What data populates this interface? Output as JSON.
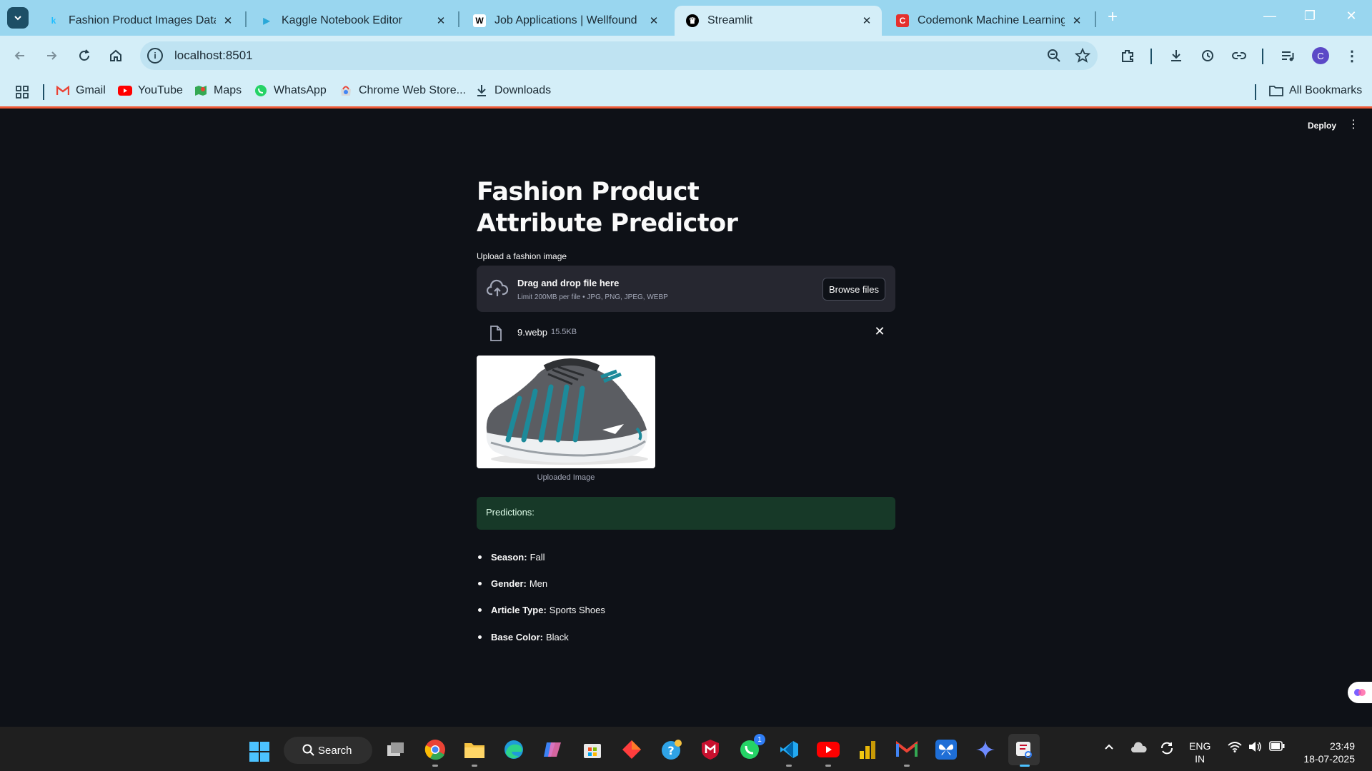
{
  "browser": {
    "tabs": [
      {
        "title": "Fashion Product Images Datase",
        "favicon": "kaggle-icon"
      },
      {
        "title": "Kaggle Notebook Editor",
        "favicon": "play-icon"
      },
      {
        "title": "Job Applications | Wellfound",
        "favicon": "wellfound-icon"
      },
      {
        "title": "Streamlit",
        "favicon": "streamlit-icon",
        "active": true
      },
      {
        "title": "Codemonk Machine Learning Ir",
        "favicon": "codemonk-icon"
      }
    ],
    "url": "localhost:8501",
    "profile_initial": "C",
    "bookmarks": [
      {
        "label": "Gmail",
        "icon": "gmail-icon"
      },
      {
        "label": "YouTube",
        "icon": "youtube-icon"
      },
      {
        "label": "Maps",
        "icon": "maps-icon"
      },
      {
        "label": "WhatsApp",
        "icon": "whatsapp-icon"
      },
      {
        "label": "Chrome Web Store...",
        "icon": "chrome-web-store-icon"
      },
      {
        "label": "Downloads",
        "icon": "download-icon"
      }
    ],
    "all_bookmarks_label": "All Bookmarks"
  },
  "app": {
    "deploy_label": "Deploy",
    "title": "Fashion Product Attribute Predictor",
    "uploader": {
      "label": "Upload a fashion image",
      "drag_text": "Drag and drop file here",
      "limit_text": "Limit 200MB per file • JPG, PNG, JPEG, WEBP",
      "browse_label": "Browse files"
    },
    "file": {
      "name": "9.webp",
      "size": "15.5KB"
    },
    "image_caption": "Uploaded Image",
    "predictions_label": "Predictions:",
    "predictions": [
      {
        "key": "Season:",
        "value": "Fall"
      },
      {
        "key": "Gender:",
        "value": "Men"
      },
      {
        "key": "Article Type:",
        "value": "Sports Shoes"
      },
      {
        "key": "Base Color:",
        "value": "Black"
      }
    ]
  },
  "taskbar": {
    "search_label": "Search",
    "whatsapp_badge": "1",
    "lang_line1": "ENG",
    "lang_line2": "IN",
    "time": "23:49",
    "date": "18-07-2025"
  },
  "colors": {
    "tab_strip": "#99d6ef",
    "toolbar": "#d4eef8",
    "app_bg": "#0e1117",
    "dropzone": "#262730",
    "success_bg": "#173928"
  }
}
